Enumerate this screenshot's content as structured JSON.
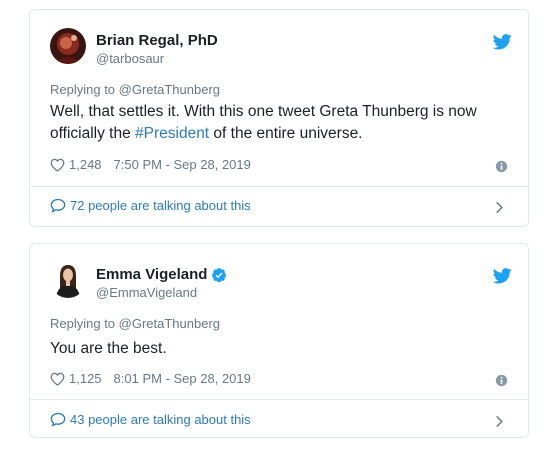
{
  "colors": {
    "link": "#2b7bb9",
    "muted": "#697882",
    "text": "#1c2022",
    "border": "#e1e8ed",
    "verified": "#1da1f2"
  },
  "tweets": [
    {
      "name": "Brian Regal, PhD",
      "handle": "@tarbosaur",
      "verified": false,
      "reply_prefix": "Replying to ",
      "reply_handle": "@GretaThunberg",
      "text_before": "Well, that settles it. With this one tweet Greta Thunberg is now officially the ",
      "hashtag": "#President",
      "text_after": " of the entire universe.",
      "likes": "1,248",
      "timestamp": "7:50 PM - Sep 28, 2019",
      "talking": "72 people are talking about this",
      "icons": [
        "heart-icon",
        "info-icon",
        "speech-bubble-icon",
        "chevron-right-icon",
        "twitter-bird-icon"
      ]
    },
    {
      "name": "Emma Vigeland",
      "handle": "@EmmaVigeland",
      "verified": true,
      "reply_prefix": "Replying to ",
      "reply_handle": "@GretaThunberg",
      "text_before": "You are the best.",
      "hashtag": "",
      "text_after": "",
      "likes": "1,125",
      "timestamp": "8:01 PM - Sep 28, 2019",
      "talking": "43 people are talking about this",
      "icons": [
        "heart-icon",
        "info-icon",
        "speech-bubble-icon",
        "chevron-right-icon",
        "twitter-bird-icon",
        "verified-badge-icon"
      ]
    }
  ]
}
